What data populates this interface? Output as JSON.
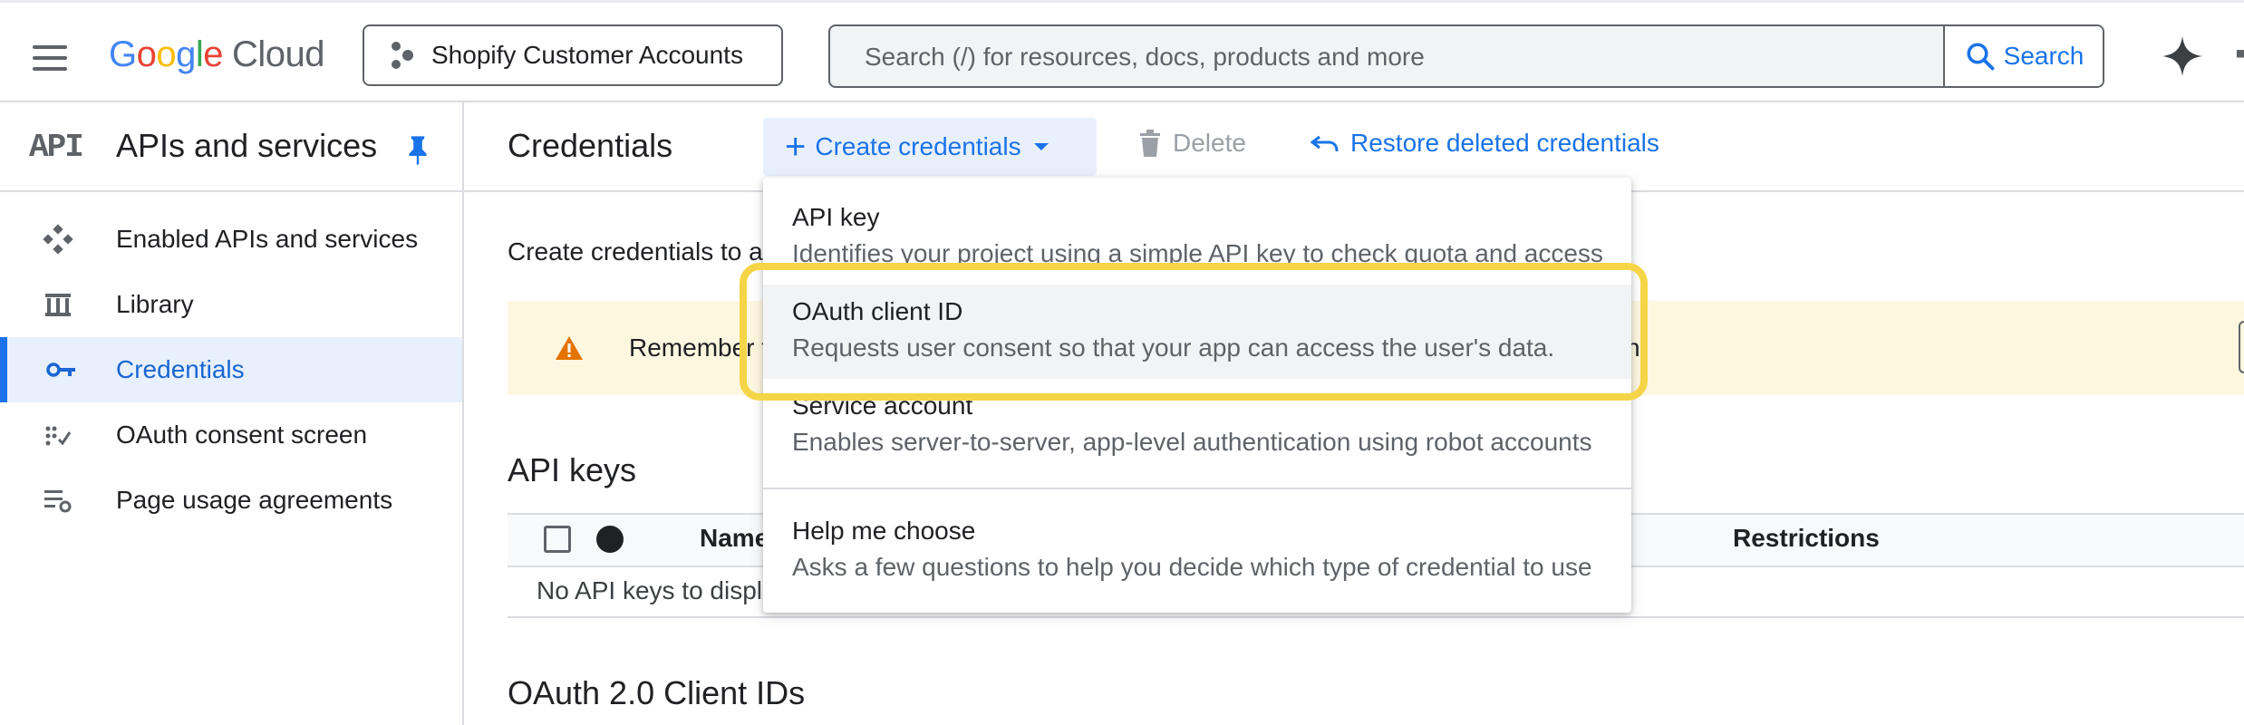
{
  "topbar": {
    "logo_google": "Google",
    "logo_cloud": "Cloud",
    "project_name": "Shopify Customer Accounts",
    "search_placeholder": "Search (/) for resources, docs, products and more",
    "search_button": "Search"
  },
  "sidebar": {
    "api_logo": "API",
    "title": "APIs and services",
    "items": [
      {
        "label": "Enabled APIs and services",
        "icon": "enabled-apis-icon"
      },
      {
        "label": "Library",
        "icon": "library-icon"
      },
      {
        "label": "Credentials",
        "icon": "key-icon",
        "active": true
      },
      {
        "label": "OAuth consent screen",
        "icon": "consent-icon"
      },
      {
        "label": "Page usage agreements",
        "icon": "settings-list-icon"
      }
    ]
  },
  "header": {
    "title": "Credentials",
    "create_label": "Create credentials",
    "delete_label": "Delete",
    "restore_label": "Restore deleted credentials"
  },
  "main": {
    "intro_text": "Create credentials to a",
    "warning_text": "Remember t",
    "warning_tail": "n",
    "api_keys_title": "API keys",
    "col_name": "Name",
    "col_restrictions": "Restrictions",
    "empty_text": "No API keys to displ",
    "oauth_title": "OAuth 2.0 Client IDs"
  },
  "dropdown": {
    "items": [
      {
        "title": "API key",
        "desc": "Identifies your project using a simple API key to check quota and access"
      },
      {
        "title": "OAuth client ID",
        "desc": "Requests user consent so that your app can access the user's data."
      },
      {
        "title": "Service account",
        "desc": "Enables server-to-server, app-level authentication using robot accounts"
      },
      {
        "title": "Help me choose",
        "desc": "Asks a few questions to help you decide which type of credential to use"
      }
    ]
  },
  "colors": {
    "accent": "#1a73e8",
    "highlight": "#f5d547",
    "warning_bg": "#fef7e0",
    "warning_icon": "#e37400"
  }
}
